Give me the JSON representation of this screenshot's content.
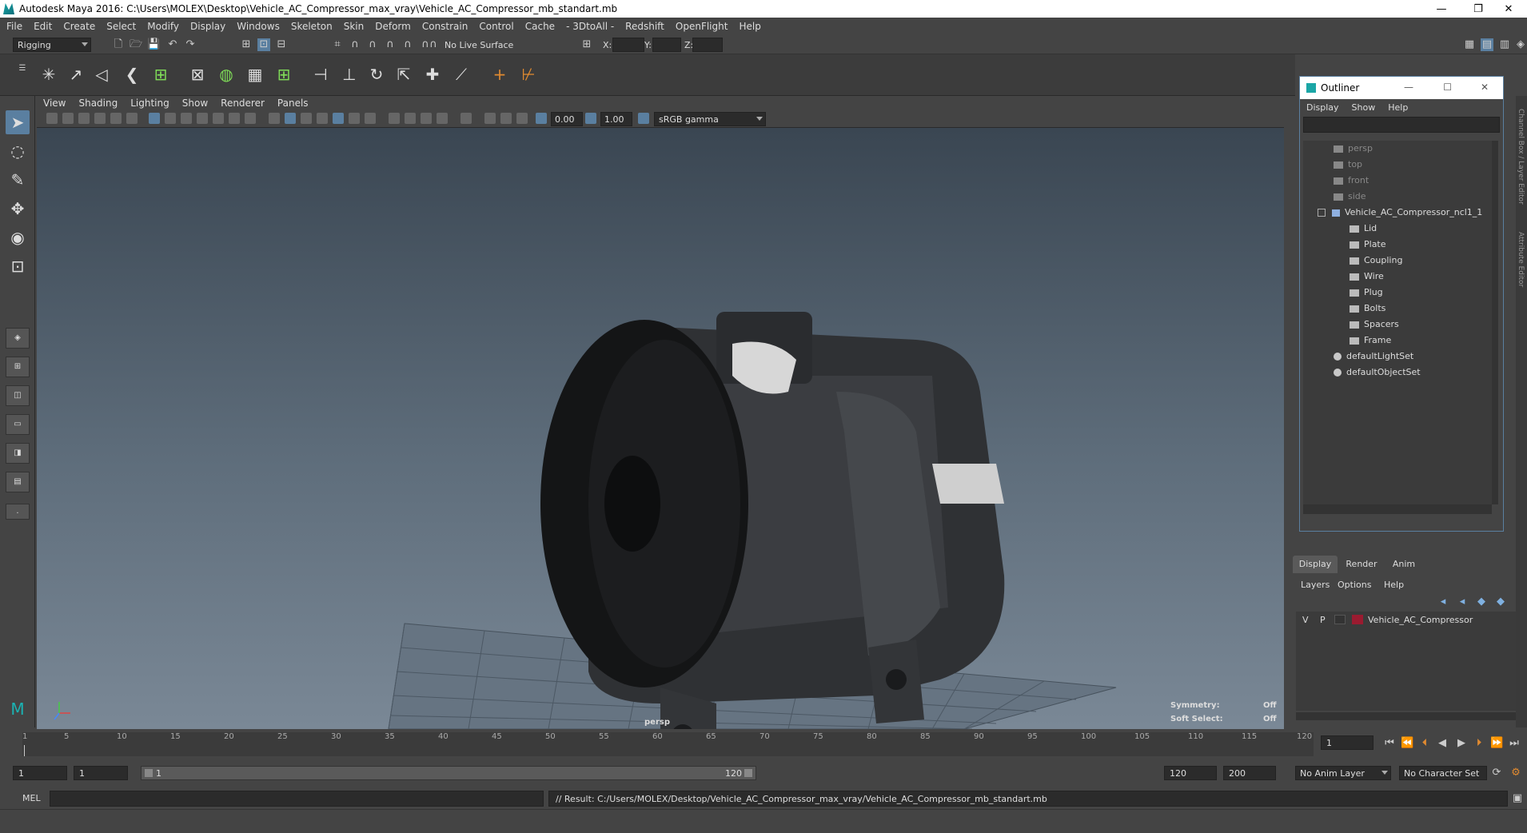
{
  "window": {
    "title": "Autodesk Maya 2016: C:\\Users\\MOLEX\\Desktop\\Vehicle_AC_Compressor_max_vray\\Vehicle_AC_Compressor_mb_standart.mb",
    "minimize": "—",
    "restore": "❐",
    "close": "✕"
  },
  "menubar": [
    "File",
    "Edit",
    "Create",
    "Select",
    "Modify",
    "Display",
    "Windows",
    "Skeleton",
    "Skin",
    "Deform",
    "Constrain",
    "Control",
    "Cache",
    "- 3DtoAll -",
    "Redshift",
    "OpenFlight",
    "Help"
  ],
  "statusline": {
    "menuset": "Rigging",
    "live_surface": "No Live Surface",
    "x_label": "X:",
    "y_label": "Y:",
    "z_label": "Z:"
  },
  "panel": {
    "menu": [
      "View",
      "Shading",
      "Lighting",
      "Show",
      "Renderer",
      "Panels"
    ],
    "exposure": "0.00",
    "gamma": "1.00",
    "colorspace": "sRGB gamma"
  },
  "viewport": {
    "camera": "persp",
    "symmetry_label": "Symmetry:",
    "symmetry_value": "Off",
    "soft_select_label": "Soft Select:",
    "soft_select_value": "Off"
  },
  "outliner": {
    "title": "Outliner",
    "menu": [
      "Display",
      "Show",
      "Help"
    ],
    "items": [
      {
        "label": "persp",
        "type": "camera",
        "depth": 1
      },
      {
        "label": "top",
        "type": "camera",
        "depth": 1
      },
      {
        "label": "front",
        "type": "camera",
        "depth": 1
      },
      {
        "label": "side",
        "type": "camera",
        "depth": 1
      },
      {
        "label": "Vehicle_AC_Compressor_ncl1_1",
        "type": "group",
        "depth": 1
      },
      {
        "label": "Lid",
        "type": "mesh",
        "depth": 2
      },
      {
        "label": "Plate",
        "type": "mesh",
        "depth": 2
      },
      {
        "label": "Coupling",
        "type": "mesh",
        "depth": 2
      },
      {
        "label": "Wire",
        "type": "mesh",
        "depth": 2
      },
      {
        "label": "Plug",
        "type": "mesh",
        "depth": 2
      },
      {
        "label": "Bolts",
        "type": "mesh",
        "depth": 2
      },
      {
        "label": "Spacers",
        "type": "mesh",
        "depth": 2
      },
      {
        "label": "Frame",
        "type": "mesh",
        "depth": 2
      },
      {
        "label": "defaultLightSet",
        "type": "set",
        "depth": 1
      },
      {
        "label": "defaultObjectSet",
        "type": "set",
        "depth": 1
      }
    ]
  },
  "layers": {
    "tabs": [
      "Display",
      "Render",
      "Anim"
    ],
    "menu": [
      "Layers",
      "Options",
      "Help"
    ],
    "rows": [
      {
        "v": "V",
        "p": "P",
        "name": "Vehicle_AC_Compressor",
        "color": "#9a1b30"
      }
    ]
  },
  "side_tabs": [
    "Channel Box / Layer Editor",
    "Attribute Editor"
  ],
  "timeline": {
    "ticks": [
      "1",
      "5",
      "10",
      "15",
      "20",
      "25",
      "30",
      "35",
      "40",
      "45",
      "50",
      "55",
      "60",
      "65",
      "70",
      "75",
      "80",
      "85",
      "90",
      "95",
      "100",
      "105",
      "110",
      "115",
      "120"
    ],
    "current_frame": "1"
  },
  "range": {
    "start": "1",
    "playback_start": "1",
    "slider_start": "1",
    "slider_end": "120",
    "playback_end": "120",
    "end": "200",
    "anim_layer": "No Anim Layer",
    "character_set": "No Character Set"
  },
  "command": {
    "language": "MEL",
    "result": "// Result: C:/Users/MOLEX/Desktop/Vehicle_AC_Compressor_max_vray/Vehicle_AC_Compressor_mb_standart.mb"
  },
  "colors": {
    "accent": "#5a7fa0",
    "layer_color": "#9a1b30"
  }
}
